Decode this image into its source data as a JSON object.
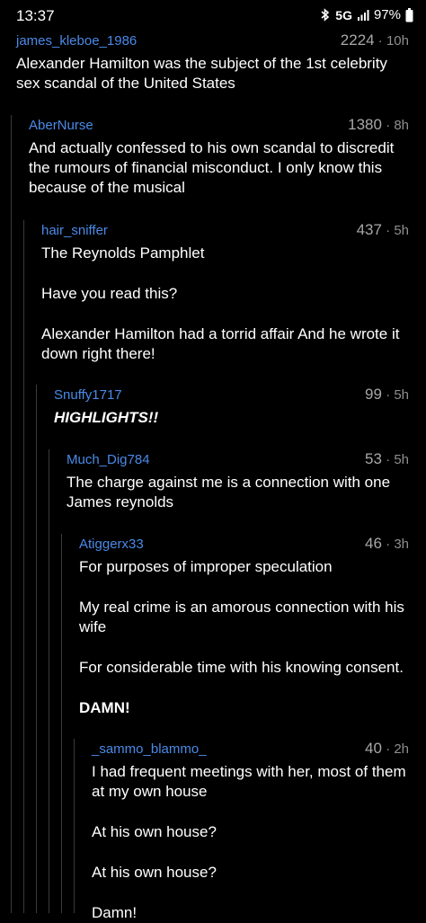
{
  "status_bar": {
    "time": "13:37",
    "network": "5G",
    "battery": "97%",
    "icons": [
      "bluetooth-icon",
      "signal-icon",
      "battery-icon"
    ]
  },
  "comments": [
    {
      "user": "james_kleboe_1986",
      "score": "2224",
      "age": "10h",
      "body": [
        "Alexander Hamilton was the subject of the 1st celebrity sex scandal of the United States"
      ]
    },
    {
      "user": "AberNurse",
      "score": "1380",
      "age": "8h",
      "body": [
        "And actually confessed to his own scandal to discredit the rumours of financial misconduct. I only know this because of the musical"
      ]
    },
    {
      "user": "hair_sniffer",
      "score": "437",
      "age": "5h",
      "body": [
        "The Reynolds Pamphlet",
        "Have you read this?",
        "Alexander Hamilton had a torrid affair And he wrote it down right there!"
      ]
    },
    {
      "user": "Snuffy1717",
      "score": "99",
      "age": "5h",
      "body": [
        "HIGHLIGHTS!!"
      ]
    },
    {
      "user": "Much_Dig784",
      "score": "53",
      "age": "5h",
      "body": [
        "The charge against me is a connection with one James reynolds"
      ]
    },
    {
      "user": "Atiggerx33",
      "score": "46",
      "age": "3h",
      "body": [
        "For purposes of improper speculation",
        "My real crime is an amorous connection with his wife",
        "For considerable time with his knowing consent.",
        "DAMN!"
      ]
    },
    {
      "user": "_sammo_blammo_",
      "score": "40",
      "age": "2h",
      "body": [
        "I had frequent meetings with her, most of them at my own house",
        "At his own house?",
        "At his own house?",
        "Damn!"
      ]
    }
  ],
  "separator": "·",
  "colors": {
    "background": "#000000",
    "username": "#4a8ae8",
    "meta": "#8f8f8f",
    "text": "#ffffff",
    "thread_line": "#3a3a3a"
  }
}
